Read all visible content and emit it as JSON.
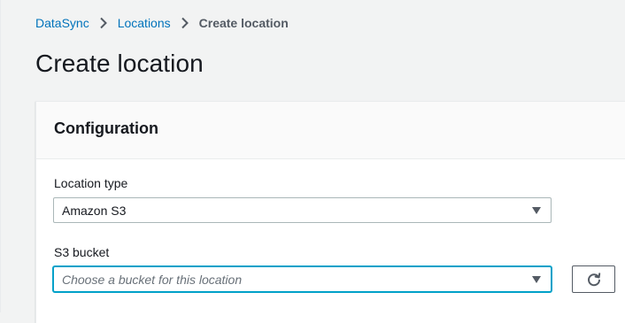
{
  "breadcrumb": {
    "items": [
      "DataSync",
      "Locations"
    ],
    "current": "Create location"
  },
  "page": {
    "title": "Create location"
  },
  "configuration": {
    "title": "Configuration",
    "location_type": {
      "label": "Location type",
      "value": "Amazon S3"
    },
    "s3_bucket": {
      "label": "S3 bucket",
      "placeholder": "Choose a bucket for this location"
    },
    "refresh_icon": "refresh-icon"
  },
  "colors": {
    "link": "#0073bb",
    "focus": "#00a1c9",
    "background": "#f2f3f3"
  }
}
